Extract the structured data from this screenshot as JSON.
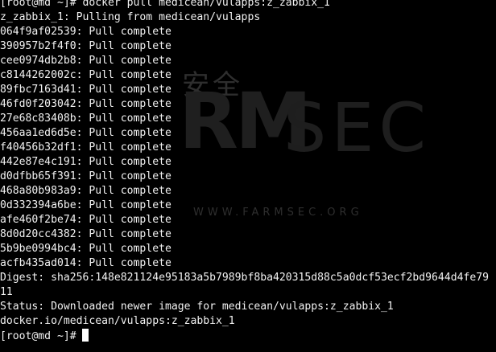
{
  "watermark": {
    "chinese_text": "安全",
    "brand_mark": "RM",
    "brand_text": "SEC",
    "url": "WWW.FARMSEC.ORG"
  },
  "terminal": {
    "lines": [
      "[root@md ~]# docker pull medicean/vulapps:z_zabbix_1",
      "z_zabbix_1: Pulling from medicean/vulapps",
      "064f9af02539: Pull complete",
      "390957b2f4f0: Pull complete",
      "cee0974db2b8: Pull complete",
      "c8144262002c: Pull complete",
      "89fbc7163d41: Pull complete",
      "46fd0f203042: Pull complete",
      "27e68c83408b: Pull complete",
      "456aa1ed6d5e: Pull complete",
      "f40456b32df1: Pull complete",
      "442e87e4c191: Pull complete",
      "d0dfbb65f391: Pull complete",
      "468a80b983a9: Pull complete",
      "0d332394a6be: Pull complete",
      "afe460f2be74: Pull complete",
      "8d0d20cc4382: Pull complete",
      "5b9be0994bc4: Pull complete",
      "acfb435ad014: Pull complete",
      "Digest: sha256:148e821124e95183a5b7989bf8ba420315d88c5a0dcf53ecf2bd9644d4fe79",
      "11",
      "Status: Downloaded newer image for medicean/vulapps:z_zabbix_1",
      "docker.io/medicean/vulapps:z_zabbix_1",
      "[root@md ~]# "
    ]
  }
}
